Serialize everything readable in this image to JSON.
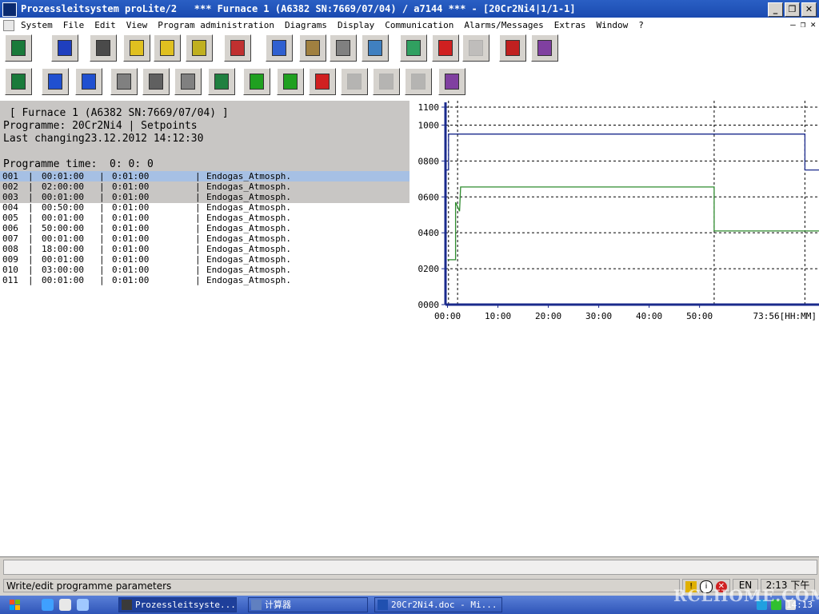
{
  "window": {
    "title": "Prozessleitsystem proLite/2   *** Furnace 1 (A6382 SN:7669/07/04) / a7144 *** - [20Cr2Ni4|1/1-1]"
  },
  "menu": [
    "System",
    "File",
    "Edit",
    "View",
    "Program administration",
    "Diagrams",
    "Display",
    "Communication",
    "Alarms/Messages",
    "Extras",
    "Window",
    "?"
  ],
  "toolbar1": [
    {
      "icon": "save-question-icon",
      "color": "#1a7a3a"
    },
    {
      "icon": "program-tree-icon",
      "color": "#1f3fbf"
    },
    {
      "icon": "flow-chart-icon",
      "color": "#4a4a4a"
    },
    {
      "icon": "table-yellow-icon",
      "color": "#e0c020"
    },
    {
      "icon": "table-edit-icon",
      "color": "#e0c020"
    },
    {
      "icon": "recipe-parameter-icon",
      "color": "#c0b020"
    },
    {
      "icon": "curve-beta-icon",
      "color": "#c03030"
    },
    {
      "icon": "diagram-color-icon",
      "color": "#3060d0"
    },
    {
      "icon": "chart-icon",
      "color": "#a08040"
    },
    {
      "icon": "folder-chart-icon",
      "color": "#808080"
    },
    {
      "icon": "monitor-chart-icon",
      "color": "#4080c0"
    },
    {
      "icon": "communication-icon",
      "color": "#30a060"
    },
    {
      "icon": "alarm-icon",
      "color": "#d02020"
    },
    {
      "icon": "lamp-disabled-icon",
      "color": "#b0b0b0"
    },
    {
      "icon": "printer-message-icon",
      "color": "#c02020"
    },
    {
      "icon": "help-book-icon",
      "color": "#8040a0"
    }
  ],
  "toolbar2": [
    {
      "icon": "save-question-icon",
      "color": "#1a7a3a"
    },
    {
      "icon": "import-icon",
      "color": "#2050d0"
    },
    {
      "icon": "export-icon",
      "color": "#2050d0"
    },
    {
      "icon": "print-icon",
      "color": "#808080"
    },
    {
      "icon": "document-print-icon",
      "color": "#606060"
    },
    {
      "icon": "setpoint-edit-icon",
      "color": "#808080"
    },
    {
      "icon": "question-search-icon",
      "color": "#208040"
    },
    {
      "icon": "segment-insert-icon",
      "color": "#20a020"
    },
    {
      "icon": "segment-append-icon",
      "color": "#20a020"
    },
    {
      "icon": "segment-delete-icon",
      "color": "#d02020"
    },
    {
      "icon": "segment-move-disabled-icon",
      "color": "#a0a0a0"
    },
    {
      "icon": "segment-copy-disabled-icon",
      "color": "#a0a0a0"
    },
    {
      "icon": "segment-remove-disabled-icon",
      "color": "#a0a0a0"
    },
    {
      "icon": "help-book-icon",
      "color": "#8040a0"
    }
  ],
  "header": {
    "furnace": " [ Furnace 1 (A6382 SN:7669/07/04) ]",
    "programme": "Programme: 20Cr2Ni4 | Setpoints",
    "last_changing": "Last changing23.12.2012 14:12:30",
    "programme_time": "Programme time:  0: 0: 0"
  },
  "segments": [
    {
      "no": "001",
      "duration": "00:01:00",
      "time": "0:01:00",
      "atmosphere": "Endogas_Atmosph."
    },
    {
      "no": "002",
      "duration": "02:00:00",
      "time": "0:01:00",
      "atmosphere": "Endogas_Atmosph."
    },
    {
      "no": "003",
      "duration": "00:01:00",
      "time": "0:01:00",
      "atmosphere": "Endogas_Atmosph."
    },
    {
      "no": "004",
      "duration": "00:50:00",
      "time": "0:01:00",
      "atmosphere": "Endogas_Atmosph."
    },
    {
      "no": "005",
      "duration": "00:01:00",
      "time": "0:01:00",
      "atmosphere": "Endogas_Atmosph."
    },
    {
      "no": "006",
      "duration": "50:00:00",
      "time": "0:01:00",
      "atmosphere": "Endogas_Atmosph."
    },
    {
      "no": "007",
      "duration": "00:01:00",
      "time": "0:01:00",
      "atmosphere": "Endogas_Atmosph."
    },
    {
      "no": "008",
      "duration": "18:00:00",
      "time": "0:01:00",
      "atmosphere": "Endogas_Atmosph."
    },
    {
      "no": "009",
      "duration": "00:01:00",
      "time": "0:01:00",
      "atmosphere": "Endogas_Atmosph."
    },
    {
      "no": "010",
      "duration": "03:00:00",
      "time": "0:01:00",
      "atmosphere": "Endogas_Atmosph."
    },
    {
      "no": "011",
      "duration": "00:01:00",
      "time": "0:01:00",
      "atmosphere": "Endogas_Atmosph."
    }
  ],
  "selected_row": 0,
  "chart_data": {
    "type": "line",
    "y_ticks": [
      "0000",
      "0200",
      "0400",
      "0600",
      "0800",
      "1000",
      "1100"
    ],
    "y_tick_values": [
      0,
      200,
      400,
      600,
      800,
      1000,
      1100
    ],
    "ylim": [
      0,
      1100
    ],
    "x_ticks": [
      "00:00",
      "10:00",
      "20:00",
      "30:00",
      "40:00",
      "50:00",
      "73:56[HH:MM]"
    ],
    "x_tick_values": [
      0,
      10,
      20,
      30,
      40,
      50,
      70
    ],
    "xlim": [
      -0.4,
      73.7
    ],
    "grid": true,
    "segment_boundaries": [
      0.2,
      2.0,
      52.9,
      70.9
    ],
    "series": [
      {
        "color": "#1a2a8c",
        "x": [
          -0.4,
          0.2,
          0.2,
          70.9,
          70.9,
          73.7
        ],
        "y": [
          750,
          750,
          950,
          950,
          750,
          750
        ]
      },
      {
        "color": "#2e8b2e",
        "x": [
          0,
          1.6,
          1.6,
          2.4,
          2.6,
          52.9,
          52.9,
          73.7
        ],
        "y": [
          250,
          250,
          570,
          520,
          655,
          655,
          410,
          410
        ]
      }
    ],
    "colors": {
      "axis": "#1a2a8c",
      "grid": "#000000"
    }
  },
  "statusbar": {
    "message": "Write/edit programme parameters",
    "lang": "EN",
    "time": "2:13 下午"
  },
  "taskbar": {
    "tasks": [
      "Prozessleitsyste...",
      "计算器",
      "20Cr2Ni4.doc - Mi..."
    ],
    "clock": "14:13"
  },
  "watermark": "RCLHOME.COM"
}
